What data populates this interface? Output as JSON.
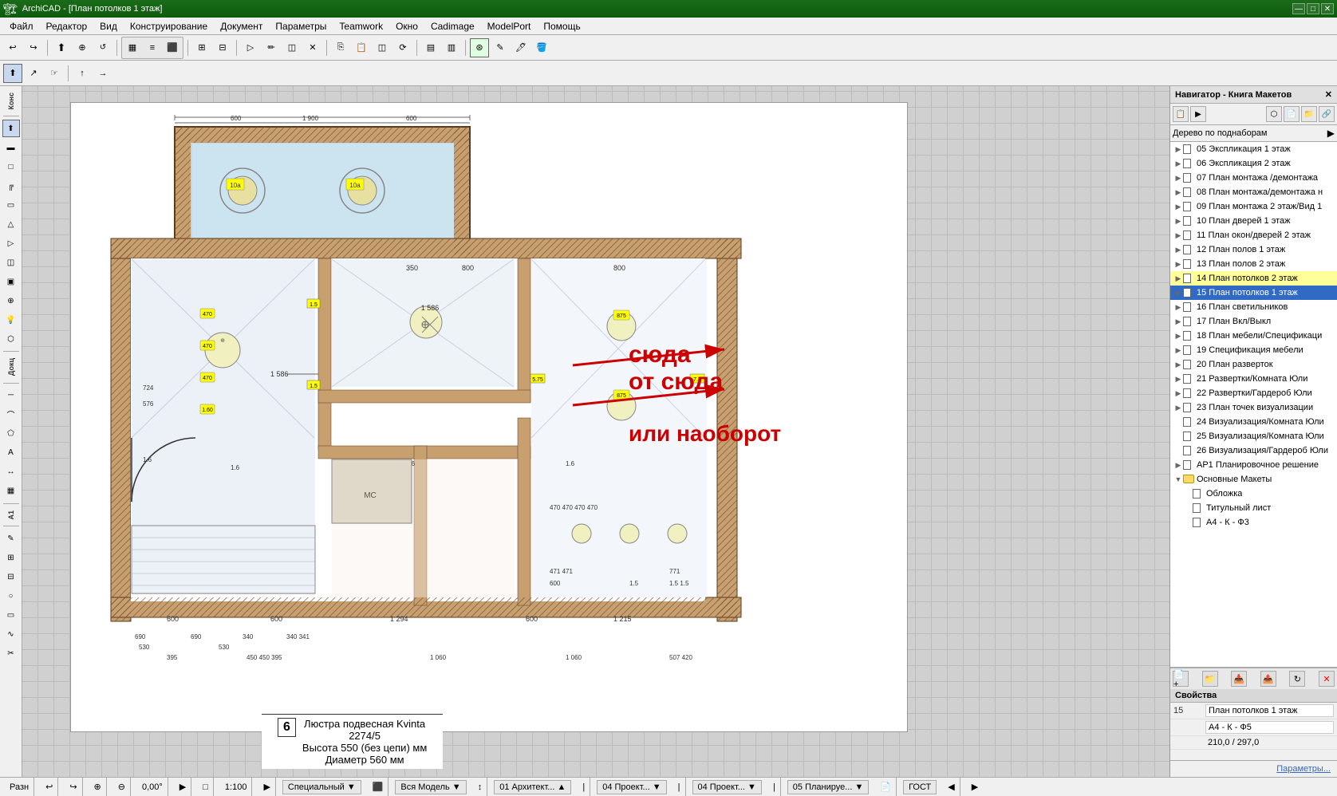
{
  "titlebar": {
    "title": "ArchiCAD - [План потолков 1 этаж]",
    "close": "✕",
    "maximize": "□",
    "minimize": "—"
  },
  "menubar": {
    "items": [
      "Файл",
      "Редактор",
      "Вид",
      "Конструирование",
      "Документ",
      "Параметры",
      "Teamwork",
      "Окно",
      "Cadimage",
      "ModelPort",
      "Помощь"
    ]
  },
  "toolbar1": {
    "buttons": [
      "↩",
      "↪",
      "↑",
      "🔍+",
      "🔍-",
      "⬜",
      "⬛",
      "⊞",
      "↕",
      "▶",
      "⬡",
      "⬢",
      "≡",
      "⊛",
      "⊕",
      "✕",
      "△",
      "▷",
      "◁",
      "▽"
    ]
  },
  "left_panel_labels": [
    "Конс",
    "Докц",
    "А1"
  ],
  "navigator": {
    "title": "Навигатор - Книга Макетов",
    "filter": "Дерево по поднаборам",
    "tree_items": [
      {
        "id": "05",
        "label": "05 Экспликация 1 этаж",
        "indent": 0,
        "type": "page",
        "expandable": true
      },
      {
        "id": "06",
        "label": "06 Экспликация 2 этаж",
        "indent": 0,
        "type": "page",
        "expandable": true
      },
      {
        "id": "07",
        "label": "07 План монтажа /демонтажа",
        "indent": 0,
        "type": "page",
        "expandable": true
      },
      {
        "id": "08",
        "label": "08 План монтажа/демонтажа н",
        "indent": 0,
        "type": "page",
        "expandable": true
      },
      {
        "id": "09",
        "label": "09 План монтажа 2 этаж/Вид 1",
        "indent": 0,
        "type": "page",
        "expandable": true
      },
      {
        "id": "10",
        "label": "10 План дверей 1 этаж",
        "indent": 0,
        "type": "page",
        "expandable": true
      },
      {
        "id": "11",
        "label": "11 План окон/дверей 2 этаж",
        "indent": 0,
        "type": "page",
        "expandable": true
      },
      {
        "id": "12",
        "label": "12 План полов 1 этаж",
        "indent": 0,
        "type": "page",
        "expandable": true
      },
      {
        "id": "13",
        "label": "13 План полов 2 этаж",
        "indent": 0,
        "type": "page",
        "expandable": true
      },
      {
        "id": "14",
        "label": "14 План потолков 2 этаж",
        "indent": 0,
        "type": "page",
        "expandable": true,
        "highlighted": true
      },
      {
        "id": "15",
        "label": "15 План потолков 1 этаж",
        "indent": 0,
        "type": "page",
        "expandable": true,
        "active": true
      },
      {
        "id": "16",
        "label": "16 План светильников",
        "indent": 0,
        "type": "page",
        "expandable": true
      },
      {
        "id": "17",
        "label": "17 План Вкл/Выкл",
        "indent": 0,
        "type": "page",
        "expandable": true
      },
      {
        "id": "18",
        "label": "18 План мебели/Спецификаци",
        "indent": 0,
        "type": "page",
        "expandable": true
      },
      {
        "id": "19",
        "label": "19 Спецификация мебели",
        "indent": 0,
        "type": "page",
        "expandable": true
      },
      {
        "id": "20",
        "label": "20 План разверток",
        "indent": 0,
        "type": "page",
        "expandable": true
      },
      {
        "id": "21",
        "label": "21 Развертки/Комната Юли",
        "indent": 0,
        "type": "page",
        "expandable": true
      },
      {
        "id": "22",
        "label": "22 Развертки/Гардероб Юли",
        "indent": 0,
        "type": "page",
        "expandable": true
      },
      {
        "id": "23",
        "label": "23 План точек визуализации",
        "indent": 0,
        "type": "page",
        "expandable": true
      },
      {
        "id": "24",
        "label": "24 Визуализация/Комната Юли",
        "indent": 0,
        "type": "page",
        "expandable": false
      },
      {
        "id": "25",
        "label": "25 Визуализация/Комната Юли",
        "indent": 0,
        "type": "page",
        "expandable": false
      },
      {
        "id": "26",
        "label": "26 Визуализация/Гардероб Юли",
        "indent": 0,
        "type": "page",
        "expandable": false
      },
      {
        "id": "AP1",
        "label": "АР1 Планировочное решение",
        "indent": 0,
        "type": "page",
        "expandable": true
      },
      {
        "id": "main",
        "label": "Основные Макеты",
        "indent": 0,
        "type": "folder",
        "expandable": true,
        "expanded": true
      },
      {
        "id": "cover",
        "label": "Обложка",
        "indent": 1,
        "type": "page",
        "expandable": false
      },
      {
        "id": "title",
        "label": "Титульный лист",
        "indent": 1,
        "type": "page",
        "expandable": false
      },
      {
        "id": "a4",
        "label": "А4 - К - Ф3",
        "indent": 1,
        "type": "page",
        "expandable": false
      }
    ]
  },
  "properties": {
    "title": "Свойства",
    "rows": [
      {
        "key": "15",
        "value": "План потолков 1 этаж"
      },
      {
        "key": "",
        "value": "А4 - К - Ф5"
      },
      {
        "key": "",
        "value": "210,0 / 297,0"
      }
    ],
    "params_label": "Параметры..."
  },
  "canvas_annotations": {
    "main_text": "сюда\nот сюда",
    "sub_text": "или наоборот"
  },
  "statusbar": {
    "items": [
      "Разн",
      "0,00°",
      "1:100",
      "Специальный",
      "Вся Модель",
      "01 Архитект...",
      "04 Проект...",
      "04 Проект...",
      "05 Планируе...",
      "ГОСТ"
    ]
  },
  "drawing_info": {
    "item_number": "6",
    "name": "Люстра подвесная Kvinta",
    "code": "2274/5",
    "height": "Высота 550 (без цепи) мм",
    "diameter": "Диаметр 560 мм"
  }
}
